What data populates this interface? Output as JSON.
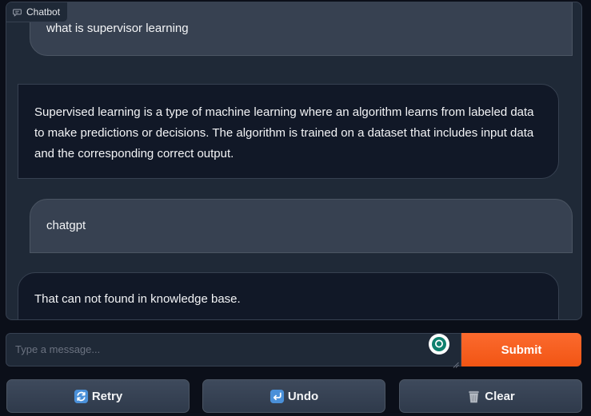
{
  "chatbot": {
    "label": "Chatbot",
    "label_icon": "chat-bubble-icon",
    "messages": [
      {
        "role": "user",
        "text": "what is supervisor learning"
      },
      {
        "role": "bot",
        "lines": [
          "Supervised learning is a type of machine learning where an algorithm learns from labeled data",
          "to make predictions or decisions. The algorithm is trained on a dataset that includes input data",
          "and the corresponding correct output."
        ]
      },
      {
        "role": "user",
        "text": "chatgpt"
      },
      {
        "role": "bot",
        "text": "That can not found in knowledge base."
      }
    ]
  },
  "composer": {
    "placeholder": "Type a message...",
    "value": "",
    "assist_icon": "assistant-bubble-icon"
  },
  "buttons": {
    "submit": "Submit",
    "retry": "Retry",
    "retry_icon": "retry-icon",
    "undo": "Undo",
    "undo_icon": "undo-icon",
    "clear": "Clear",
    "clear_icon": "trash-icon"
  },
  "colors": {
    "background": "#0b0f19",
    "panel": "#1f2937",
    "user_bubble": "#374151",
    "bot_bubble": "#111827",
    "accent": "#f97316",
    "button": "#374151"
  }
}
